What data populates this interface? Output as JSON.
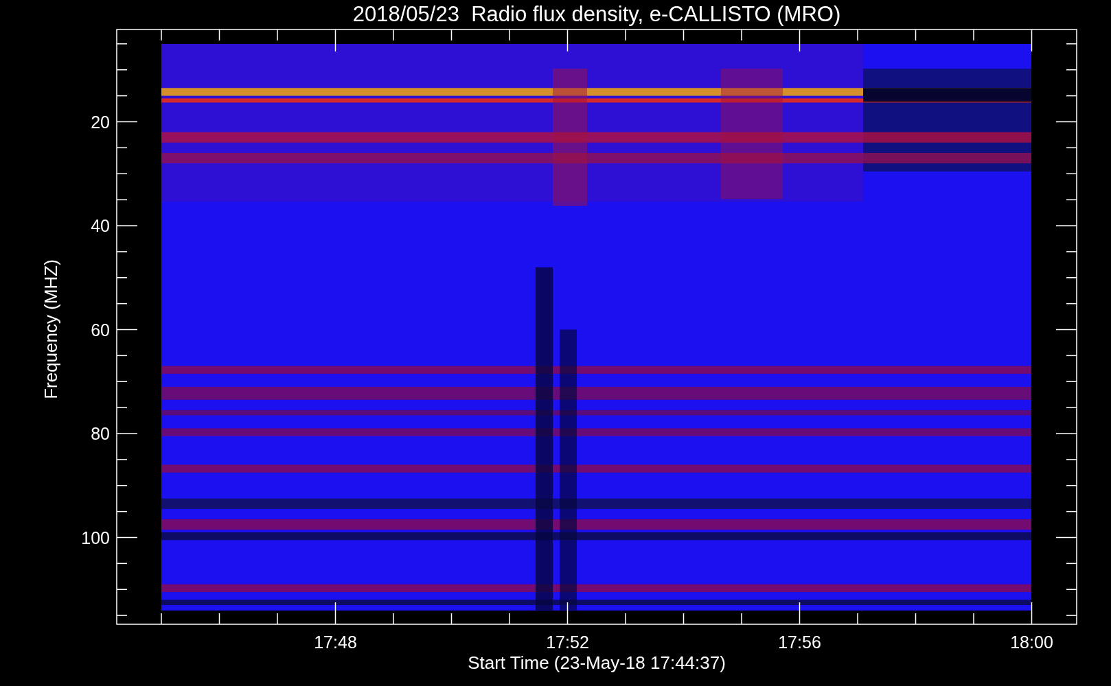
{
  "title": "2018/05/23  Radio flux density, e-CALLISTO (MRO)",
  "y_axis": {
    "label": "Frequency (MHZ)",
    "ticks": [
      "20",
      "40",
      "60",
      "80",
      "100"
    ]
  },
  "x_axis": {
    "label": "Start Time (23-May-18 17:44:37)",
    "ticks": [
      "17:48",
      "17:52",
      "17:56",
      "18:00"
    ]
  }
}
